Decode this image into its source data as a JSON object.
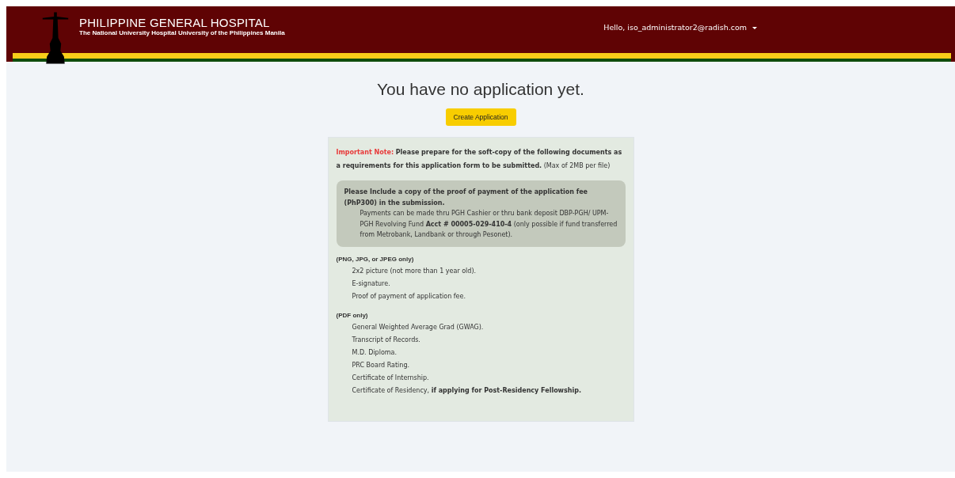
{
  "header": {
    "title": "PHILIPPINE GENERAL HOSPITAL",
    "subtitle": "The National University Hospital University of the Philippines Manila",
    "user_menu": "Hello, iso_administrator2@radish.com"
  },
  "main": {
    "heading": "You have no application yet.",
    "button": "Create Application"
  },
  "note": {
    "label": "Important Note:",
    "text": "**Please prepare for the soft-copy of the following documents as a requirements for this application form to be submitted.** (Max of 2MB per file)",
    "payment": {
      "title": "Please Include a copy of the proof of payment of the application fee (PhP300) in the submission.",
      "detail": "Payments can be made thru PGH Cashier or thru bank deposit DBP-PGH/ UPM-PGH Revolving Fund **Acct # 00005-029-410-4** (only possible if fund transferred from Metrobank, Landbank or through Pesonet)."
    },
    "groups": [
      {
        "title": "(PNG, JPG, or JPEG only)",
        "items": [
          "2x2 picture (not more than 1 year old).",
          "E-signature.",
          "Proof of payment of application fee."
        ]
      },
      {
        "title": "(PDF only)",
        "items": [
          "General Weighted Average Grad (GWAG).",
          "Transcript of Records.",
          "M.D. Diploma.",
          "PRC Board Rating.",
          "Certificate of Internship.",
          "Certificate of Residency, **if applying for Post-Residency Fellowship.**"
        ]
      }
    ]
  }
}
